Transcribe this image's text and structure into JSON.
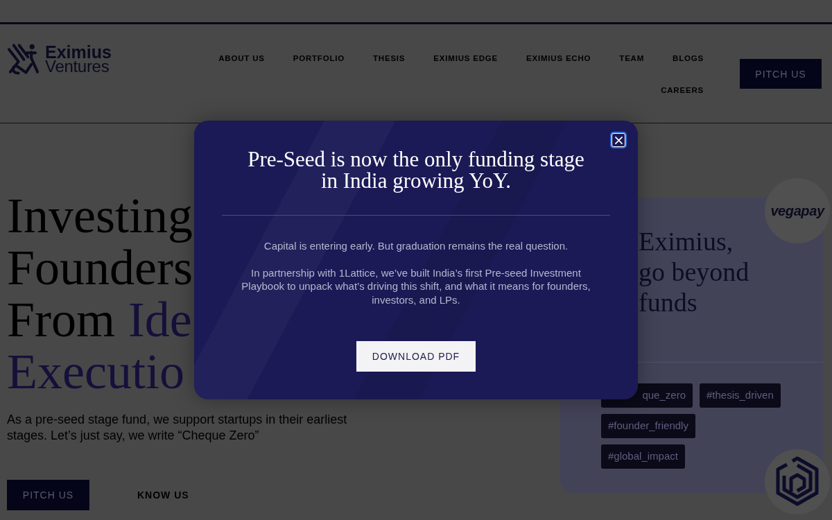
{
  "header": {
    "logo": {
      "name": "Eximius",
      "tagline": "Ventures"
    },
    "nav_links": [
      {
        "label": "ABOUT US"
      },
      {
        "label": "PORTFOLIO"
      },
      {
        "label": "THESIS"
      },
      {
        "label": "EXIMIUS EDGE"
      },
      {
        "label": "EXIMIUS ECHO"
      },
      {
        "label": "TEAM"
      },
      {
        "label": "BLOGS"
      },
      {
        "label": "CAREERS"
      }
    ],
    "pitch_button": "PITCH US"
  },
  "hero": {
    "heading_lines": [
      [
        {
          "text": "Investing",
          "accent": false
        }
      ],
      [
        {
          "text": "Founders",
          "accent": false
        }
      ],
      [
        {
          "text": "From",
          "accent": false
        },
        {
          "text": "Ide",
          "accent": true
        }
      ],
      [
        {
          "text": "Executio",
          "accent": true
        }
      ]
    ],
    "subtitle": "As a pre-seed stage fund, we support startups in their earliest stages. Let’s just say, we write “Cheque Zero”",
    "buttons": [
      {
        "label": "PITCH US",
        "kind": "primary"
      },
      {
        "label": "KNOW US",
        "kind": "text"
      }
    ]
  },
  "feature_card": {
    "logo_badge": "vegapay",
    "heading_lines": [
      "Eximius,",
      "go beyond",
      "funds"
    ],
    "tags": [
      "que_zero",
      "#thesis_driven",
      "#founder_friendly",
      "#global_impact"
    ]
  },
  "modal": {
    "title": "Pre-Seed is now the only funding stage in India growing YoY.",
    "paragraphs": [
      "Capital is entering early. But graduation remains the real question.",
      "In partnership with 1Lattice, we’ve built India’s first Pre-seed Investment Playbook to unpack what’s driving this shift, and what it means for founders, investors, and LPs."
    ],
    "button": "DOWNLOAD PDF"
  }
}
